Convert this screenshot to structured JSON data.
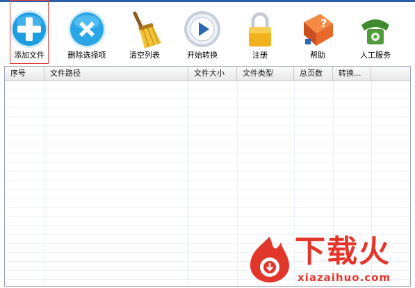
{
  "toolbar": {
    "buttons": [
      {
        "key": "add",
        "label": "添加文件",
        "icon": "plus-circle-icon"
      },
      {
        "key": "delete",
        "label": "删除选择项",
        "icon": "x-circle-icon"
      },
      {
        "key": "clear",
        "label": "清空列表",
        "icon": "broom-icon"
      },
      {
        "key": "start",
        "label": "开始转换",
        "icon": "play-icon"
      },
      {
        "key": "register",
        "label": "注册",
        "icon": "lock-icon"
      },
      {
        "key": "help",
        "label": "帮助",
        "icon": "help-book-icon"
      },
      {
        "key": "service",
        "label": "人工服务",
        "icon": "telephone-icon"
      }
    ],
    "selected": "add"
  },
  "file_list": {
    "columns": [
      "序号",
      "文件路径",
      "文件大小",
      "文件类型",
      "总页数",
      "转换..."
    ],
    "rows": []
  },
  "watermark": {
    "brand": "下载火",
    "domain": "xiazaihuo.com"
  },
  "colors": {
    "accent": "#2b5ea8",
    "add_blue": "#1e9ee0",
    "delete_blue": "#2aa6e6",
    "lock_gold": "#f2b21b",
    "help_orange": "#e8692c",
    "phone_green": "#4f9a3a",
    "watermark_red": "#e2362b"
  }
}
